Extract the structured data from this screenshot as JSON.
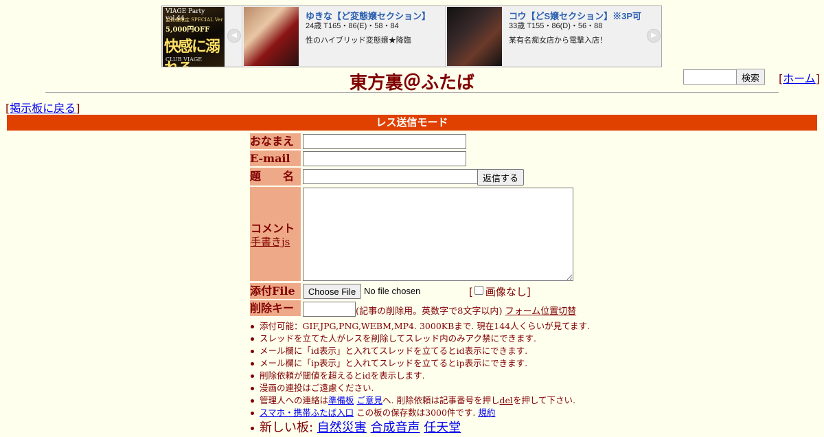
{
  "ad": {
    "logo": {
      "line1": "VIAGE Party vol.44",
      "line2": "会員様限定 SPECIAL Ver",
      "line3": "5,000円OFF",
      "line4": "快感に溺れる",
      "line5": "CLUB VIAGE"
    },
    "cards": [
      {
        "name": "ゆきな【ど変態嬢セクション】",
        "spec": "24歳 T165・86(E)・58・84",
        "desc": "性のハイブリッド変態嬢★降臨"
      },
      {
        "name": "コウ【どS嬢セクション】※3P可",
        "spec": "33歳 T155・86(D)・56・88",
        "desc": "某有名痴女店から電撃入店！"
      }
    ]
  },
  "header": {
    "title": "東方裏＠ふたば",
    "search_button": "検索",
    "home_open": "[",
    "home_link": "ホーム",
    "home_close": "]",
    "back_open": "[",
    "back_link": "掲示板に戻る",
    "back_close": "]"
  },
  "mode_bar": "レス送信モード",
  "form": {
    "name_label": "おなまえ",
    "email_label": "E-mail",
    "subject_label": "題　　名",
    "submit_button": "返信する",
    "comment_label": "コメント",
    "handwrite_link": "手書きjs",
    "file_label": "添付File",
    "file_choose_button": "Choose File",
    "file_status": "No file chosen",
    "no_image_open": "[",
    "no_image_label": "画像なし]",
    "delkey_label": "削除キー",
    "delkey_note": "(記事の削除用。英数字で8文字以内)",
    "form_toggle_link": "フォーム位置切替"
  },
  "notes": {
    "n1": "添付可能：GIF,JPG,PNG,WEBM,MP4. 3000KBまで. 現在144人くらいが見てます.",
    "n2": "スレッドを立てた人がレスを削除してスレッド内のみアク禁にできます.",
    "n3": "メール欄に「id表示」と入れてスレッドを立てるとid表示にできます.",
    "n4": "メール欄に「ip表示」と入れてスレッドを立てるとip表示にできます.",
    "n5": "削除依頼が閾値を超えるとidを表示します.",
    "n6": "漫画の連投はご遠慮ください.",
    "n7_a": "管理人への連絡は",
    "n7_link1": "準備板",
    "n7_link2": "ご意見",
    "n7_b": "へ. 削除依頼は記事番号を押し",
    "n7_link3": "del",
    "n7_c": "を押して下さい.",
    "n8_link": "スマホ・携帯ふたば入口",
    "n8_b": " この板の保存数は3000件です. ",
    "n8_link2": "規約",
    "n9_a": "新しい板: ",
    "n9_link1": "自然災害",
    "n9_link2": "合成音声",
    "n9_link3": "任天堂"
  }
}
